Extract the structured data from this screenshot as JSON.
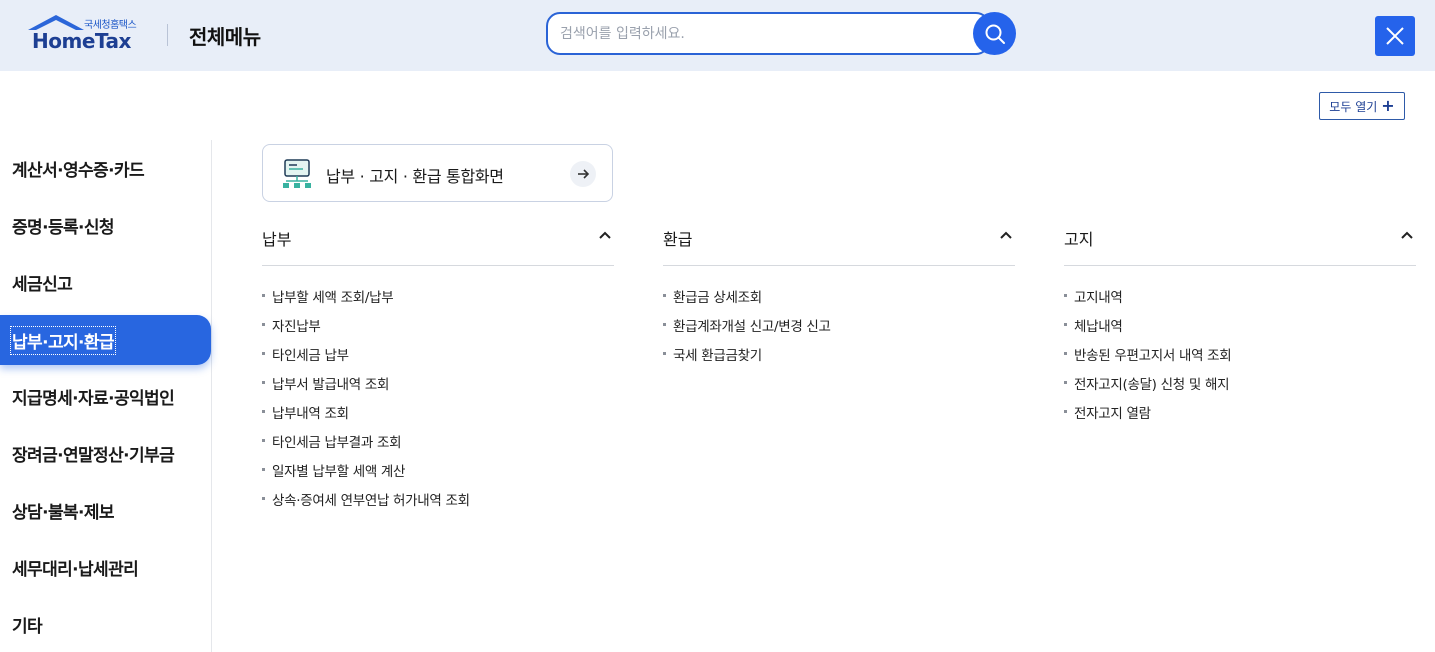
{
  "header": {
    "logo_sub": "국세청홈택스",
    "logo_main": "HomeTax",
    "title": "전체메뉴",
    "search_placeholder": "검색어를 입력하세요."
  },
  "expand_all_label": "모두 열기",
  "sidebar": {
    "items": [
      {
        "label": "계산서·영수증·카드",
        "active": false
      },
      {
        "label": "증명·등록·신청",
        "active": false
      },
      {
        "label": "세금신고",
        "active": false
      },
      {
        "label": "납부·고지·환급",
        "active": true
      },
      {
        "label": "지급명세·자료·공익법인",
        "active": false
      },
      {
        "label": "장려금·연말정산·기부금",
        "active": false
      },
      {
        "label": "상담·불복·제보",
        "active": false
      },
      {
        "label": "세무대리·납세관리",
        "active": false
      },
      {
        "label": "기타",
        "active": false
      }
    ]
  },
  "integrated_card": {
    "label": "납부 · 고지 · 환급 통합화면"
  },
  "columns": [
    {
      "title": "납부",
      "items": [
        "납부할 세액 조회/납부",
        "자진납부",
        "타인세금 납부",
        "납부서 발급내역 조회",
        "납부내역 조회",
        "타인세금 납부결과 조회",
        "일자별 납부할 세액 계산",
        "상속·증여세 연부연납 허가내역 조회"
      ]
    },
    {
      "title": "환급",
      "items": [
        "환급금 상세조회",
        "환급계좌개설 신고/변경 신고",
        "국세 환급금찾기"
      ]
    },
    {
      "title": "고지",
      "items": [
        "고지내역",
        "체납내역",
        "반송된 우편고지서 내역 조회",
        "전자고지(송달) 신청 및 해지",
        "전자고지 열람"
      ]
    }
  ],
  "colors": {
    "accent": "#2563eb",
    "header_bg": "#e8eef8",
    "active_menu": "#2866e0"
  }
}
